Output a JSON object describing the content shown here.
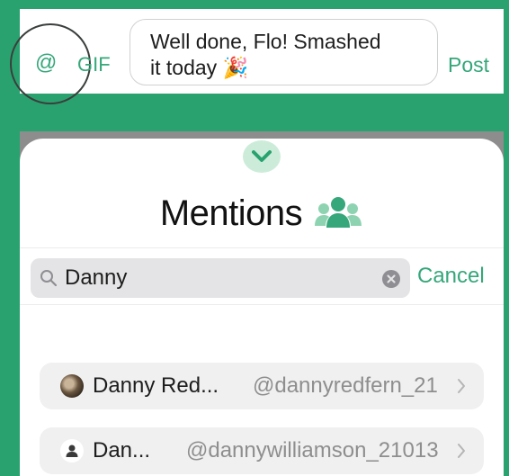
{
  "composer": {
    "at_label": "@",
    "gif_label": "GIF",
    "message_line1": "Well done, Flo! Smashed",
    "message_line2": "it today",
    "message_emoji": "🎉",
    "post_label": "Post"
  },
  "mentions": {
    "collapse_icon": "chevron-down-icon",
    "title": "Mentions",
    "title_icon": "people-icon",
    "search": {
      "value": "Danny",
      "search_icon": "search-icon",
      "clear_icon": "clear-icon",
      "cancel_label": "Cancel"
    },
    "results": [
      {
        "name": "Danny Red...",
        "handle": "@dannyredfern_21",
        "avatar": "photo"
      },
      {
        "name": "Dan...",
        "handle": "@dannywilliamson_21013",
        "avatar": "default-user-icon"
      }
    ]
  },
  "colors": {
    "background": "#2aa270",
    "accent": "#35a77a",
    "accent_light": "#ccecd9",
    "sheet_backdrop": "#8d8d8d"
  }
}
